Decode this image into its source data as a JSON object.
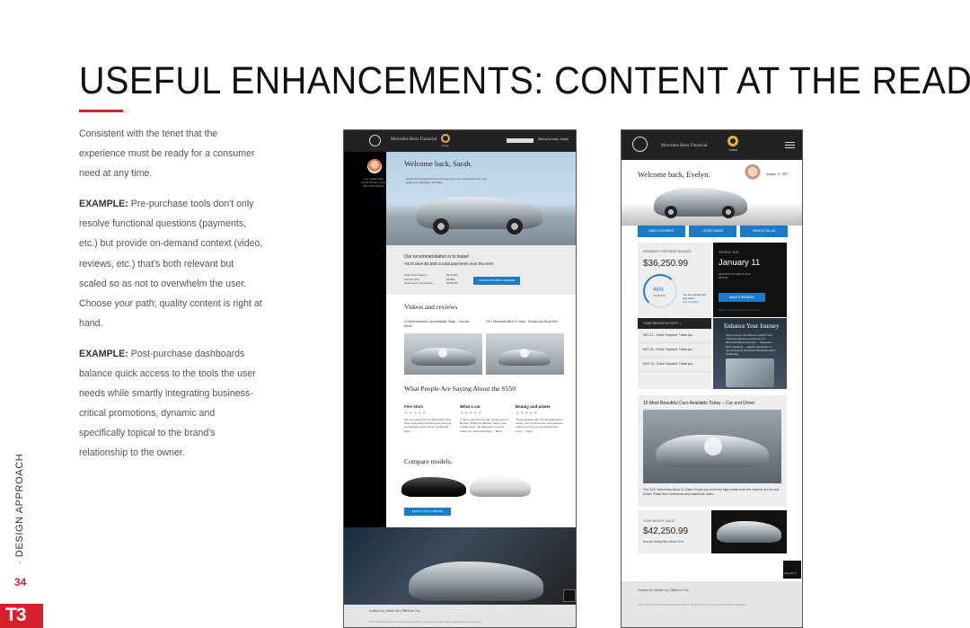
{
  "slide": {
    "title": "USEFUL ENHANCEMENTS: CONTENT AT THE READY",
    "accent_color": "#d5202b",
    "intro": "Consistent with the tenet that the experience must be ready for a consumer need at any time.",
    "example1_label": "EXAMPLE:",
    "example1_text": " Pre-purchase tools don't only resolve functional questions (payments, etc.) but provide on-demand context (video, reviews, etc.) that's both relevant but scaled so as not to overwhelm the user. Choose your path; quality content is right at hand.",
    "example2_label": "EXAMPLE:",
    "example2_text": " Post-purchase dashboards balance quick access to the tools the user needs while smartly integrating business-critical promotions, dynamic and specifically topical to the brand's relationship to the owner.",
    "side_label": "· DESIGN APPROACH",
    "page_number": "34",
    "logo": "T3"
  },
  "desktop": {
    "brand": "Mercedes-Benz Financial",
    "smart": "smart",
    "welcome_small": "Welcome back, Sarah",
    "sidebar_text": "Your relationship Sarah Stringer (310) 555-0123 (Sarah)",
    "hero_title": "Welcome back, Sarah.",
    "hero_sub": "Sarah has prepared some information for you, visit started with your leasing vs. financing calculator.",
    "reco_line1": "Our recommendation is to lease!",
    "reco_line2": "You'll save $3,559 in total payments over the term.",
    "reco_rows": "Total cost of leases\nInterest paid\nTotal cost of purchasing",
    "reco_vals": "$115,000\n$3,884\n$118,569",
    "reco_button": "CALCULATE AND COMPARE",
    "videos_title": "Videos and reviews",
    "video1_caption": "10 Most Beautiful Cars Available Today – Car and Driver",
    "video2_caption": "2017 Mercedes-Benz S-Class - Review and Road Test",
    "reviews_title": "What People Are Saying About the S550",
    "reviews": [
      {
        "head": "Five stars",
        "stars": "★★★★★",
        "body": "\"As you expect from a Mercedes, they have designed a performance and yet comfortable luxury which positioned...\" More"
      },
      {
        "head": "What a car",
        "stars": "★★★★★",
        "body": "\"I have owned for a year. Cruise over a Bentley. While the Bentley had a nicer outside style, the Mercedes is just a better car, has technology...\" More"
      },
      {
        "head": "Beauty and power",
        "stars": "★★★★★",
        "body": "\"Great smooth ride, the all suspension works. Lots of electronics and features, really too many to comprehend but some...\" More"
      }
    ],
    "compare_title": "Compare models.",
    "compare_button": "SELECT AND COMPARE",
    "footer_links": "Contact Us  |  About Us  |  Offers for You",
    "footer_legal": "©2017 Mercedes-Benz Financial Services USA LLC. All rights reserved.  Terms of Use and Privacy Statement"
  },
  "mobile": {
    "brand": "Mercedes-Benz Financial",
    "smart": "smart",
    "greeting": "Welcome back, Evelyn.",
    "date": "January 11, 2017",
    "tabs": [
      "MAKE A PAYMENT",
      "LATEST NEWS",
      "VEHICLE VALUE"
    ],
    "balance_label": "REMAINING STATEMENT BALANCE",
    "balance_value": "$36,250.99",
    "percent": "46%",
    "percent_label": "COMPLETE",
    "halfway": "You are almost half way done.",
    "payoff_link": "Pay off early?",
    "payment_label": "PAYMENT DUE",
    "payment_date": "January 11",
    "min_payment": "MINIMUM PAYMENT DUE\n$450.00",
    "payment_button": "MAKE A PAYMENT",
    "billing_link": "Billing Statements and Documents",
    "activity_header": "YOUR RECENT ACTIVITY  ⌄",
    "activity": [
      "DEC 12 - Online Payment. Thank you.",
      "DEC 04 - Online Payment. Thank you.",
      "NOV 18 - Online Payment. Thank you."
    ],
    "promo_title": "Enhance Your Journey",
    "promo_text": "Apply now for the Platinum Card® from American Express exclusively for Mercedes-Benz and earn ... Mercedes-Benz Rewards ... eligible purchases on the Card at an authorized Mercedes-Benz dealership.",
    "video_title": "10 Most Beautiful Cars Available Today – Car and Driver",
    "video_caption": "The 2017 Mercedes-Benz S-Class Coupe just received high praise from the experts at Car and Driver. Read their comments and watch the video.",
    "value_label": "YOUR VEHICLE VALUE",
    "value_amount": "$42,250.99",
    "value_source": "Source: Kelley Blue Book",
    "value_more": "More",
    "chat_label": "Chat with Us",
    "footer_links": "Contact Us  |  About Us  |  Offers for You",
    "footer_legal": "©2017 Mercedes-Benz Financial Services USA LLC. All rights reserved.   Terms of Use and Privacy Statement"
  }
}
